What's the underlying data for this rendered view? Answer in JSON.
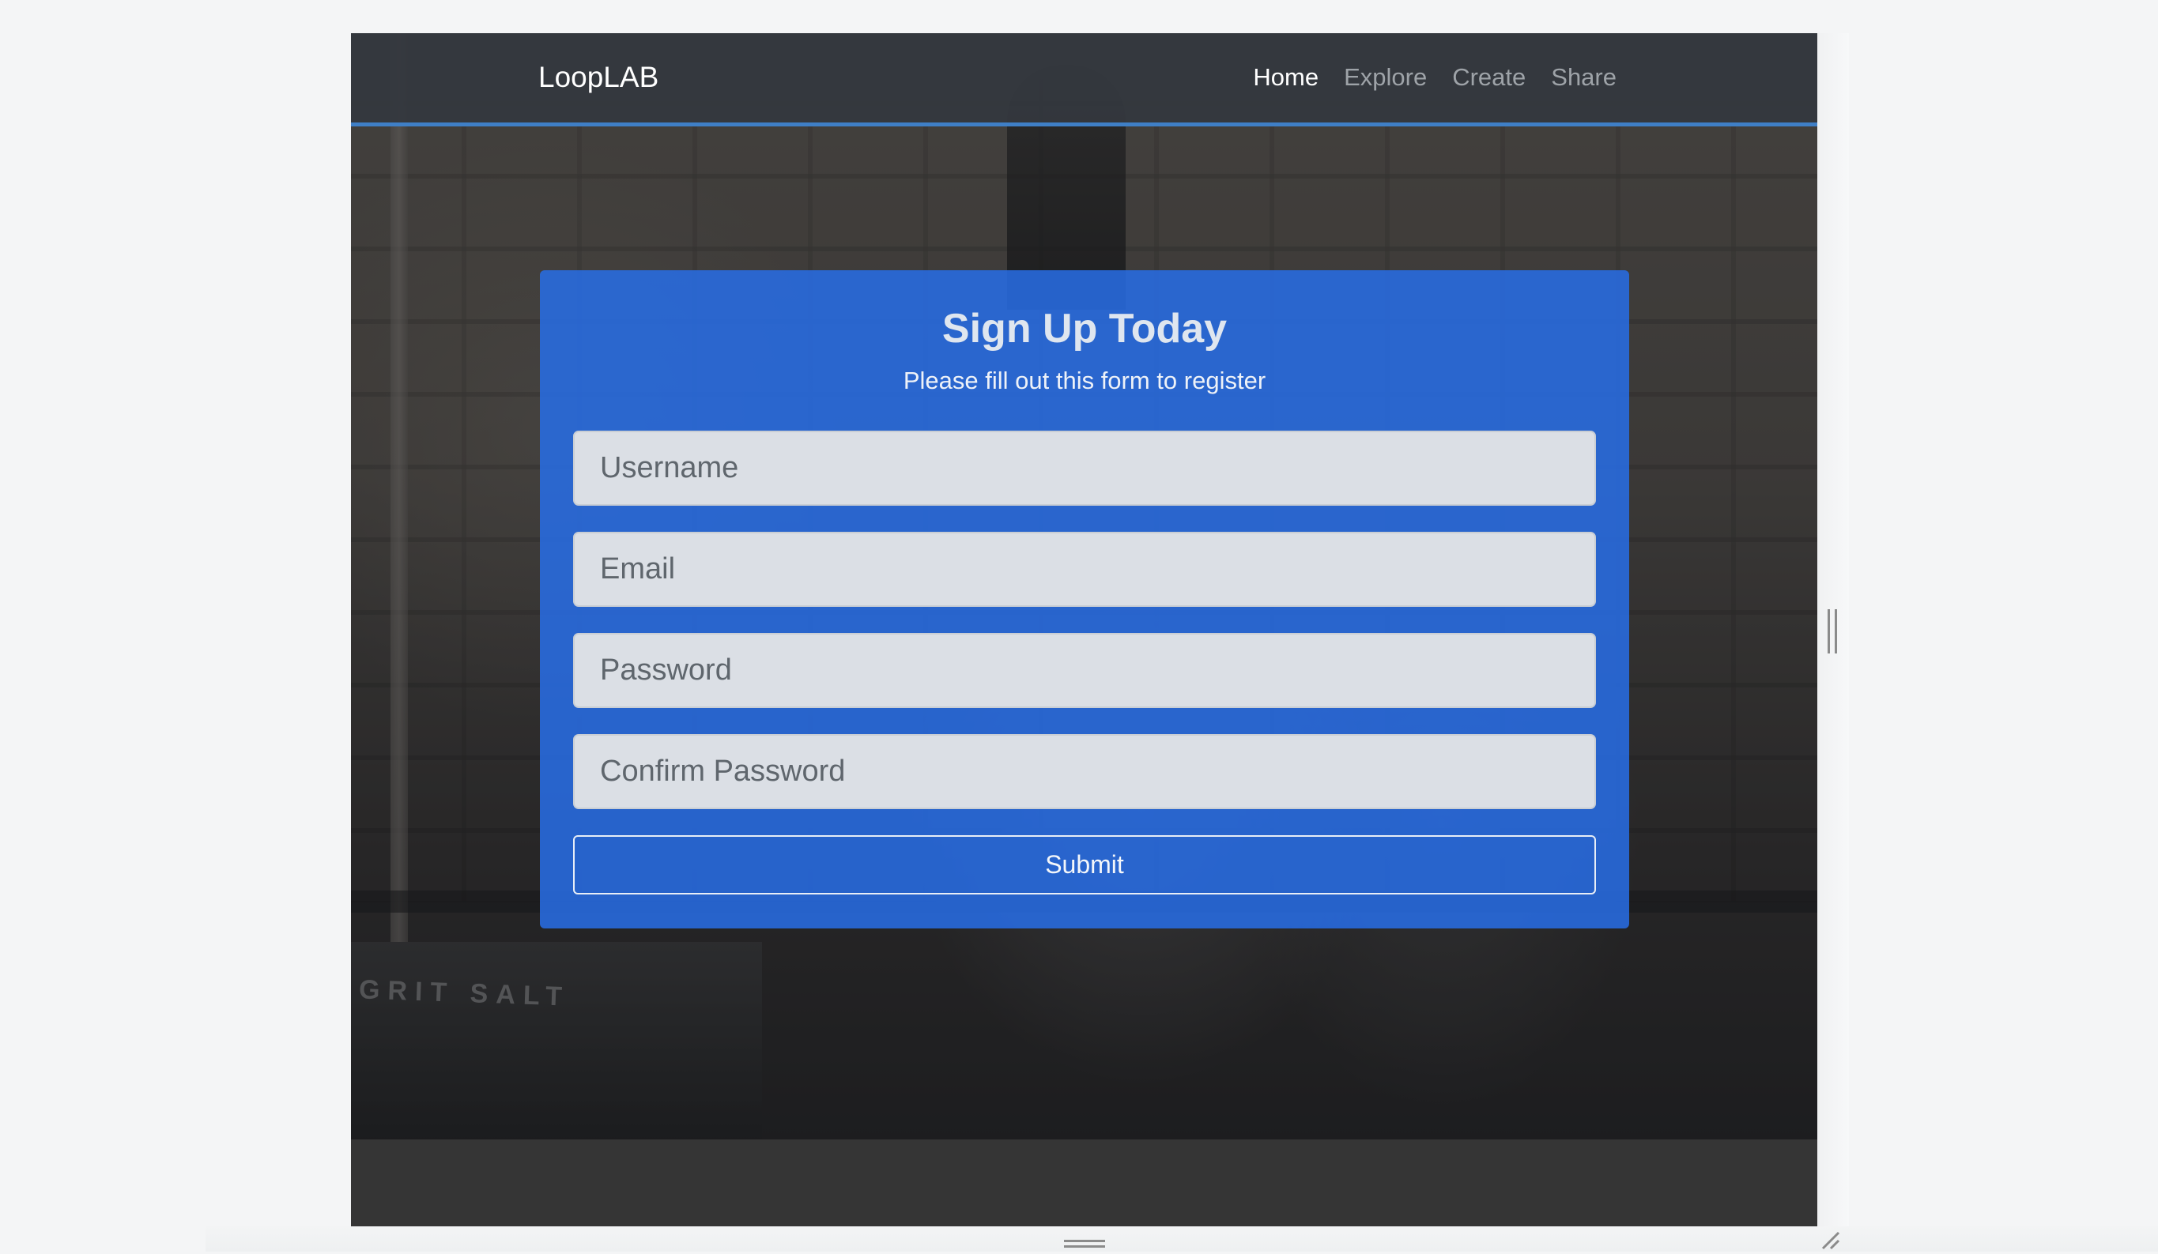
{
  "navbar": {
    "brand": "LoopLAB",
    "links": [
      {
        "label": "Home",
        "active": true
      },
      {
        "label": "Explore",
        "active": false
      },
      {
        "label": "Create",
        "active": false
      },
      {
        "label": "Share",
        "active": false
      }
    ]
  },
  "signup": {
    "title": "Sign Up Today",
    "subtitle": "Please fill out this form to register",
    "fields": {
      "username": {
        "placeholder": "Username",
        "value": ""
      },
      "email": {
        "placeholder": "Email",
        "value": ""
      },
      "password": {
        "placeholder": "Password",
        "value": ""
      },
      "confirm_password": {
        "placeholder": "Confirm Password",
        "value": ""
      }
    },
    "submit_label": "Submit"
  },
  "hero": {
    "sign_text": "GRIT SALT"
  },
  "colors": {
    "accent": "#3f7fc6",
    "card_blue": "#286ee6",
    "navbar_bg": "#34383e",
    "footer_bg": "#353535"
  }
}
